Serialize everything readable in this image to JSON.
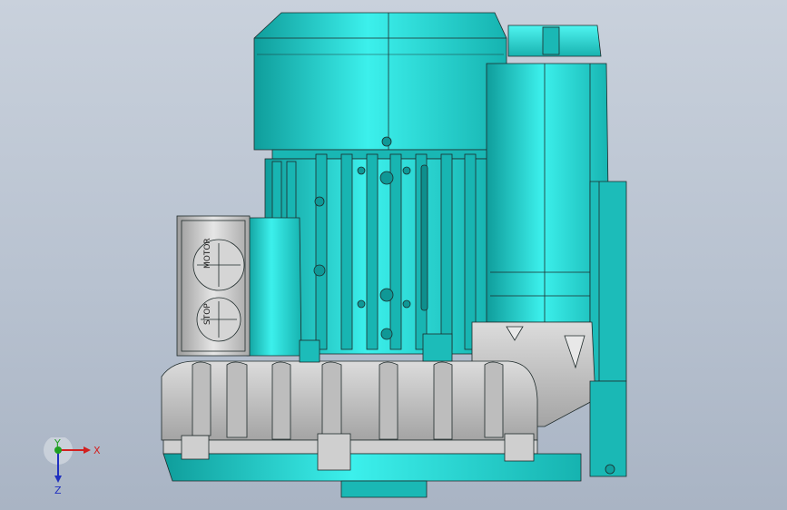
{
  "window": {
    "title": ""
  },
  "model": {
    "plate_labels": [
      "MOTOR",
      "STOP"
    ],
    "colors": {
      "teal": "#2bd3cf",
      "teal_dark": "#10a8a6",
      "teal_light": "#5ff2ee",
      "grey": "#c8c8c8",
      "grey_dark": "#9a9a9a",
      "edge": "#1e2a2a"
    }
  },
  "triad": {
    "x_label": "X",
    "y_label": "Y",
    "z_label": "Z",
    "x_color": "#d22020",
    "y_color": "#20a020",
    "z_color": "#2030c0"
  }
}
